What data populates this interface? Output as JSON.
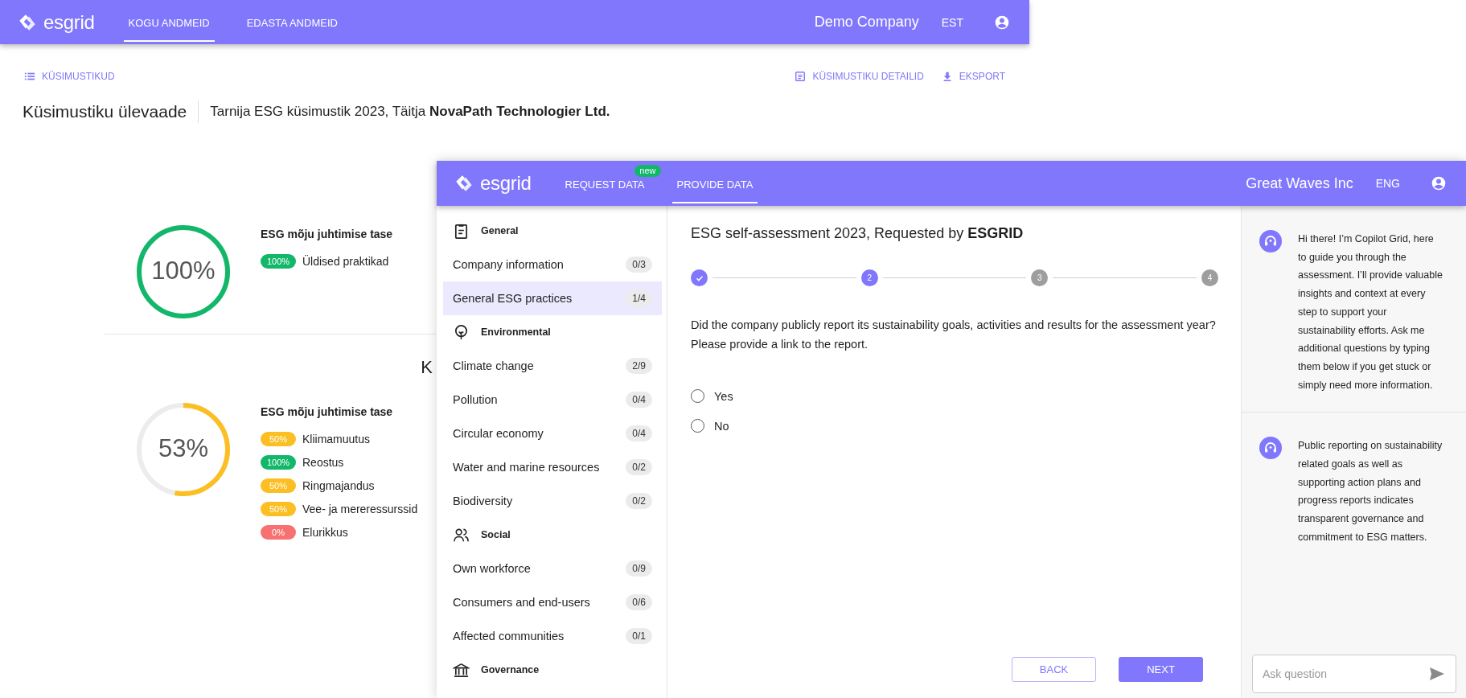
{
  "back_window": {
    "nav": {
      "logo": "esgrid",
      "tabs": [
        {
          "label": "KOGU ANDMEID",
          "selected": true
        },
        {
          "label": "EDASTA ANDMEID",
          "selected": false
        }
      ],
      "company": "Demo Company",
      "language": "EST"
    },
    "toolbar": {
      "back_link": "KÜSIMUSTIKUD",
      "actions": [
        {
          "kind": "details",
          "label": "KÜSIMUSTIKU DETAILID"
        },
        {
          "kind": "export",
          "label": "EKSPORT"
        }
      ]
    },
    "page_title": "Küsimustiku ülevaade",
    "subtitle": "Tarnija ESG küsimustik 2023, Täitja **NovaPath Technologier Ltd.**",
    "sections": [
      {
        "score": "100%",
        "level": 1.0,
        "color": "#12b76a",
        "heading": "ESG mõju juhtimise tase",
        "items": [
          {
            "percent": "100%",
            "label": "Üldised praktikad",
            "color": "#12b76a"
          }
        ]
      },
      {
        "cut_heading": "K"
      },
      {
        "score": "53%",
        "level": 0.53,
        "color": "#fbbf24",
        "heading": "ESG mõju juhtimise tase",
        "items": [
          {
            "percent": "50%",
            "label": "Kliimamuutus",
            "color": "#fbbf24"
          },
          {
            "percent": "100%",
            "label": "Reostus",
            "color": "#12b76a"
          },
          {
            "percent": "50%",
            "label": "Ringmajandus",
            "color": "#fbbf24"
          },
          {
            "percent": "50%",
            "label": "Vee- ja mereressurssid",
            "color": "#fbbf24"
          },
          {
            "percent": "0%",
            "label": "Elurikkus",
            "color": "#f87171"
          }
        ]
      }
    ]
  },
  "front_window": {
    "nav": {
      "logo": "esgrid",
      "tabs": [
        {
          "label": "REQUEST DATA",
          "badge": "new",
          "selected": false
        },
        {
          "label": "PROVIDE DATA",
          "selected": true
        }
      ],
      "company": "Great Waves Inc",
      "language": "ENG"
    },
    "sidebar": [
      {
        "kind": "clipboard",
        "title": "General",
        "items": [
          {
            "label": "Company information",
            "count": "0/3",
            "selected": false
          },
          {
            "label": "General ESG practices",
            "count": "1/4",
            "selected": true
          }
        ]
      },
      {
        "kind": "tree",
        "title": "Environmental",
        "items": [
          {
            "label": "Climate change",
            "count": "2/9",
            "selected": false
          },
          {
            "label": "Pollution",
            "count": "0/4",
            "selected": false
          },
          {
            "label": "Circular economy",
            "count": "0/4",
            "selected": false
          },
          {
            "label": "Water and marine resources",
            "count": "0/2",
            "selected": false
          },
          {
            "label": "Biodiversity",
            "count": "0/2",
            "selected": false
          }
        ]
      },
      {
        "kind": "people",
        "title": "Social",
        "items": [
          {
            "label": "Own workforce",
            "count": "0/9",
            "selected": false
          },
          {
            "label": "Consumers and end-users",
            "count": "0/6",
            "selected": false
          },
          {
            "label": "Affected communities",
            "count": "0/1",
            "selected": false
          }
        ]
      },
      {
        "kind": "bank",
        "title": "Governance"
      }
    ],
    "main": {
      "title": "ESG self-assessment 2023, Requested by **ESGRID**",
      "steps": [
        {
          "completed": true,
          "current": false
        },
        {
          "completed": false,
          "current": true,
          "label": "2"
        },
        {
          "completed": false,
          "current": false,
          "label": "3"
        },
        {
          "completed": false,
          "current": false,
          "label": "4"
        }
      ],
      "question": "Did the company publicly report its sustainability goals, activities and results for the assessment year? Please provide a link to the report.",
      "options": [
        {
          "label": "Yes",
          "selected": false
        },
        {
          "label": "No",
          "selected": false
        }
      ],
      "buttons": [
        {
          "kind": "outline",
          "label": "BACK"
        },
        {
          "kind": "primary",
          "label": "NEXT"
        }
      ]
    },
    "chat": {
      "messages": [
        "Hi there! I’m Copilot Grid, here to guide you through the assessment. I’ll provide valuable insights and context at every step to support your sustainability efforts. Ask me additional questions by typing them below if you get stuck or simply need more information.",
        "Public reporting on sustainability related goals as well as supporting action plans and progress reports indicates transparent governance and commitment to ESG matters."
      ],
      "input": {
        "placeholder": "Ask question"
      }
    }
  }
}
